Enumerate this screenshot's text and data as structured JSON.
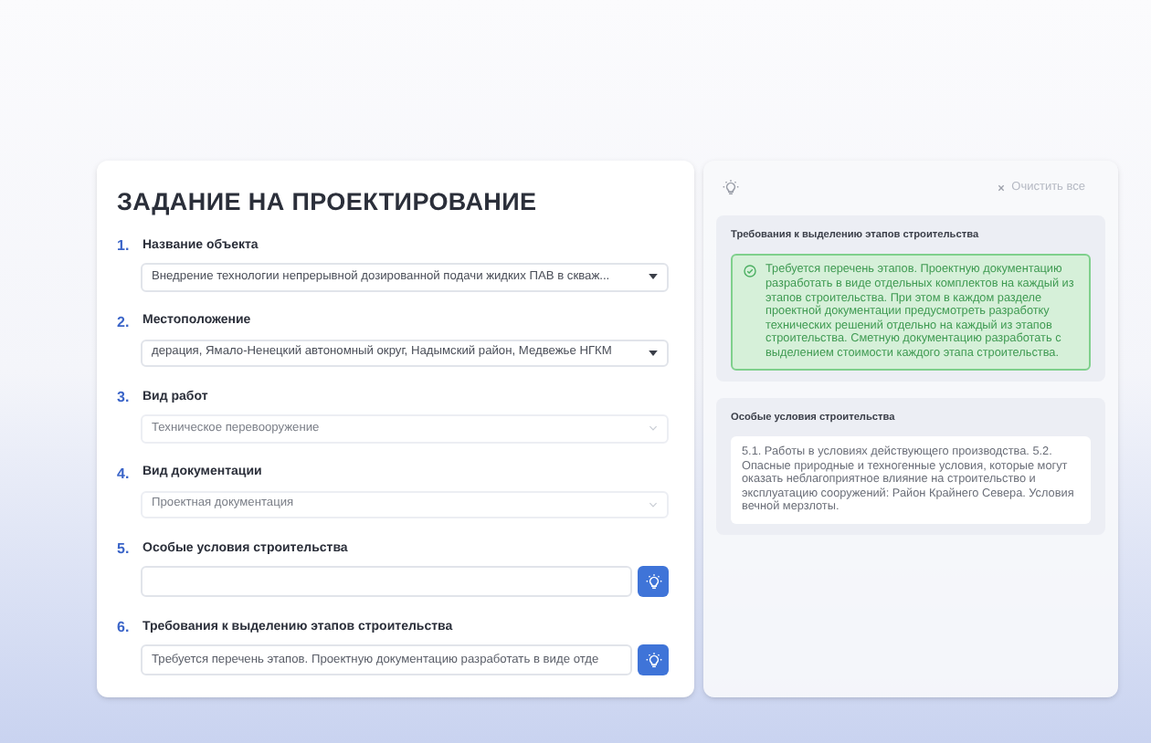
{
  "form": {
    "title": "ЗАДАНИЕ НА ПРОЕКТИРОВАНИЕ",
    "fields": [
      {
        "number": "1.",
        "label": "Название объекта",
        "kind": "dropdown",
        "disabled": false,
        "value": "Внедрение технологии непрерывной дозированной подачи жидких ПАВ в скваж..."
      },
      {
        "number": "2.",
        "label": "Местоположение",
        "kind": "dropdown",
        "disabled": false,
        "value": "дерация, Ямало-Ненецкий автономный округ, Надымский район, Медвежье НГКМ"
      },
      {
        "number": "3.",
        "label": "Вид работ",
        "kind": "dropdown",
        "disabled": true,
        "value": "Техническое перевооружение"
      },
      {
        "number": "4.",
        "label": "Вид документации",
        "kind": "dropdown",
        "disabled": true,
        "value": "Проектная документация"
      },
      {
        "number": "5.",
        "label": "Особые условия строительства",
        "kind": "input"
      },
      {
        "number": "6.",
        "label": "Требования к выделению этапов строительства",
        "kind": "input",
        "value": "Требуется перечень этапов. Проектную документацию разработать в виде отде"
      }
    ]
  },
  "suggestions": {
    "clear_label": "Очистить все",
    "sections": [
      {
        "title": "Требования к выделению этапов строительства",
        "accepted": true,
        "text": "Требуется перечень этапов. Проектную документацию разработать в виде отдельных комплектов на каждый из этапов строительства. При этом в каждом разделе проектной документации предусмотреть разработку технических решений отдельно на каждый из этапов строительства. Сметную документацию разработать с выделением стоимости каждого этапа строительства."
      },
      {
        "title": "Особые условия строительства",
        "accepted": false,
        "text": "5.1. Работы в условиях действующего производства. 5.2. Опасные природные и техногенные условия, которые могут оказать неблагоприятное влияние на строительство и эксплуатацию сооружений: Район Крайнего Севера. Условия вечной мерзлоты."
      }
    ]
  }
}
